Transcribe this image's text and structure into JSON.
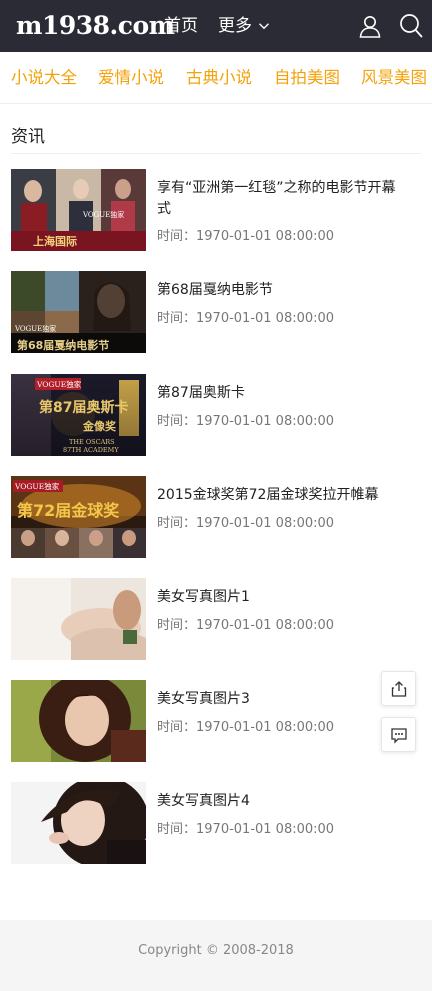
{
  "header": {
    "logo": "m1938.com",
    "nav": {
      "home": "首页",
      "more": "更多"
    },
    "icons": {
      "user": "user-icon",
      "search": "search-icon",
      "more_chevron": "chevron-down-icon"
    }
  },
  "categories": [
    "小说大全",
    "爱情小说",
    "古典小说",
    "自拍美图",
    "风景美图"
  ],
  "section": {
    "title": "资讯"
  },
  "articles": [
    {
      "title": "享有“亚洲第一红毯”之称的电影节开幕式",
      "time": "时间：1970-01-01 08:00:00",
      "thumb_caption": "VOGUE独家 上海国际"
    },
    {
      "title": "第68届戛纳电影节",
      "time": "时间：1970-01-01 08:00:00",
      "thumb_caption": "VOGUE独家 第68届戛纳电影节"
    },
    {
      "title": "第87届奥斯卡",
      "time": "时间：1970-01-01 08:00:00",
      "thumb_caption": "VOGUE独家 第87届奥斯卡金像奖 THE OSCARS 87TH ACADEMY"
    },
    {
      "title": "2015金球奖第72届金球奖拉开帷幕",
      "time": "时间：1970-01-01 08:00:00",
      "thumb_caption": "VOGUE独家 第72届金球奖"
    },
    {
      "title": "美女写真图片1",
      "time": "时间：1970-01-01 08:00:00",
      "thumb_caption": ""
    },
    {
      "title": "美女写真图片3",
      "time": "时间：1970-01-01 08:00:00",
      "thumb_caption": ""
    },
    {
      "title": "美女写真图片4",
      "time": "时间：1970-01-01 08:00:00",
      "thumb_caption": ""
    }
  ],
  "floating": {
    "share_icon": "share-icon",
    "comment_icon": "comment-icon"
  },
  "footer": {
    "copyright": "Copyright © 2008-2018"
  },
  "colors": {
    "topbar": "#2b2b35",
    "category": "#f5a20a",
    "footer_bg": "#f5f5f5"
  }
}
